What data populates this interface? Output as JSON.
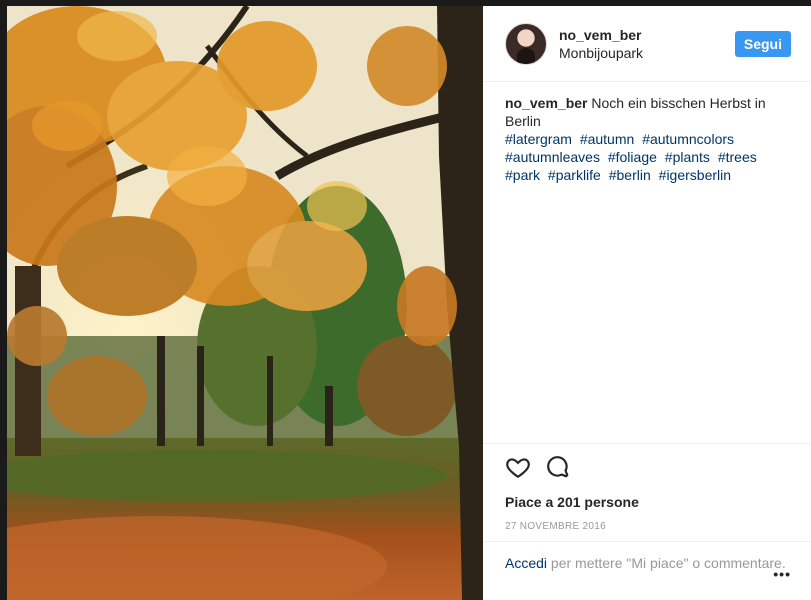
{
  "post": {
    "image_alt": "Autumn trees with orange leaves in Monbijoupark, Berlin",
    "header": {
      "username": "no_vem_ber",
      "location": "Monbijoupark",
      "follow_label": "Segui"
    },
    "caption": {
      "username": "no_vem_ber",
      "text": "Noch ein bisschen Herbst in Berlin",
      "hashtags": [
        "#latergram",
        "#autumn",
        "#autumncolors",
        "#autumnleaves",
        "#foliage",
        "#plants",
        "#trees",
        "#park",
        "#parklife",
        "#berlin",
        "#igersberlin"
      ]
    },
    "actions": {
      "like_icon": "heart-icon",
      "comment_icon": "comment-icon"
    },
    "likes_text": "Piace a 201 persone",
    "date": "27 NOVEMBRE 2016",
    "footer": {
      "login_label": "Accedi",
      "login_suffix": " per mettere \"Mi piace\" o commentare.",
      "more_label": "•••"
    }
  },
  "colors": {
    "follow_button": "#3897f0",
    "hashtag": "#003569",
    "muted": "#999999",
    "text": "#262626"
  }
}
